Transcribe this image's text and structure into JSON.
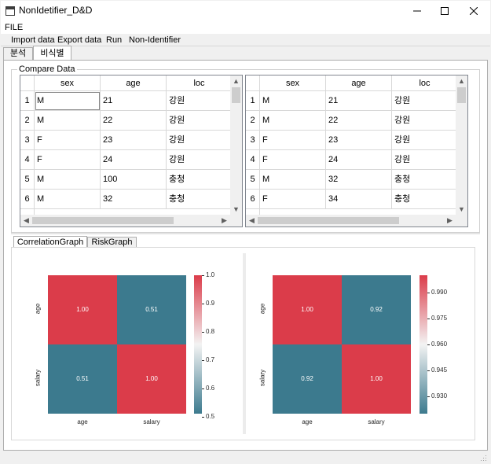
{
  "window": {
    "title": "NonIdetifier_D&D"
  },
  "menu": {
    "file": "FILE"
  },
  "toolbar": {
    "items": [
      "Import data",
      "Export data",
      "Run",
      "Non-Identifier"
    ]
  },
  "tabs": [
    "분석",
    "비식별"
  ],
  "compare": {
    "title": "Compare Data",
    "left": {
      "headers": [
        "sex",
        "age",
        "loc"
      ],
      "rows": [
        [
          "1",
          "M",
          "21",
          "강원"
        ],
        [
          "2",
          "M",
          "22",
          "강원"
        ],
        [
          "3",
          "F",
          "23",
          "강원"
        ],
        [
          "4",
          "F",
          "24",
          "강원"
        ],
        [
          "5",
          "M",
          "100",
          "충청"
        ],
        [
          "6",
          "M",
          "32",
          "충청"
        ]
      ]
    },
    "right": {
      "headers": [
        "sex",
        "age",
        "loc"
      ],
      "rows": [
        [
          "1",
          "M",
          "21",
          "강원"
        ],
        [
          "2",
          "M",
          "22",
          "강원"
        ],
        [
          "3",
          "F",
          "23",
          "강원"
        ],
        [
          "4",
          "F",
          "24",
          "강원"
        ],
        [
          "5",
          "M",
          "32",
          "충청"
        ],
        [
          "6",
          "F",
          "34",
          "충청"
        ]
      ]
    }
  },
  "graph_tabs": [
    "CorrelationGraph",
    "RiskGraph"
  ],
  "chart_data": [
    {
      "type": "heatmap",
      "x_labels": [
        "age",
        "salary"
      ],
      "y_labels": [
        "age",
        "salary"
      ],
      "values": [
        [
          1.0,
          0.51
        ],
        [
          0.51,
          1.0
        ]
      ],
      "cell_labels": [
        [
          "1.00",
          "0.51"
        ],
        [
          "0.51",
          "1.00"
        ]
      ],
      "colorbar_ticks": [
        "1.0",
        "0.9",
        "0.8",
        "0.7",
        "0.6",
        "0.5"
      ],
      "colorbar_range": [
        0.51,
        1.0
      ],
      "colors": {
        "low": "#3c7a8e",
        "mid": "#f3f3f3",
        "high": "#db3c4a"
      }
    },
    {
      "type": "heatmap",
      "x_labels": [
        "age",
        "salary"
      ],
      "y_labels": [
        "age",
        "salary"
      ],
      "values": [
        [
          1.0,
          0.92
        ],
        [
          0.92,
          1.0
        ]
      ],
      "cell_labels": [
        [
          "1.00",
          "0.92"
        ],
        [
          "0.92",
          "1.00"
        ]
      ],
      "colorbar_ticks": [
        "0.990",
        "0.975",
        "0.960",
        "0.945",
        "0.930"
      ],
      "colorbar_range": [
        0.92,
        1.0
      ],
      "colors": {
        "low": "#3c7a8e",
        "mid": "#f3f3f3",
        "high": "#db3c4a"
      }
    }
  ]
}
